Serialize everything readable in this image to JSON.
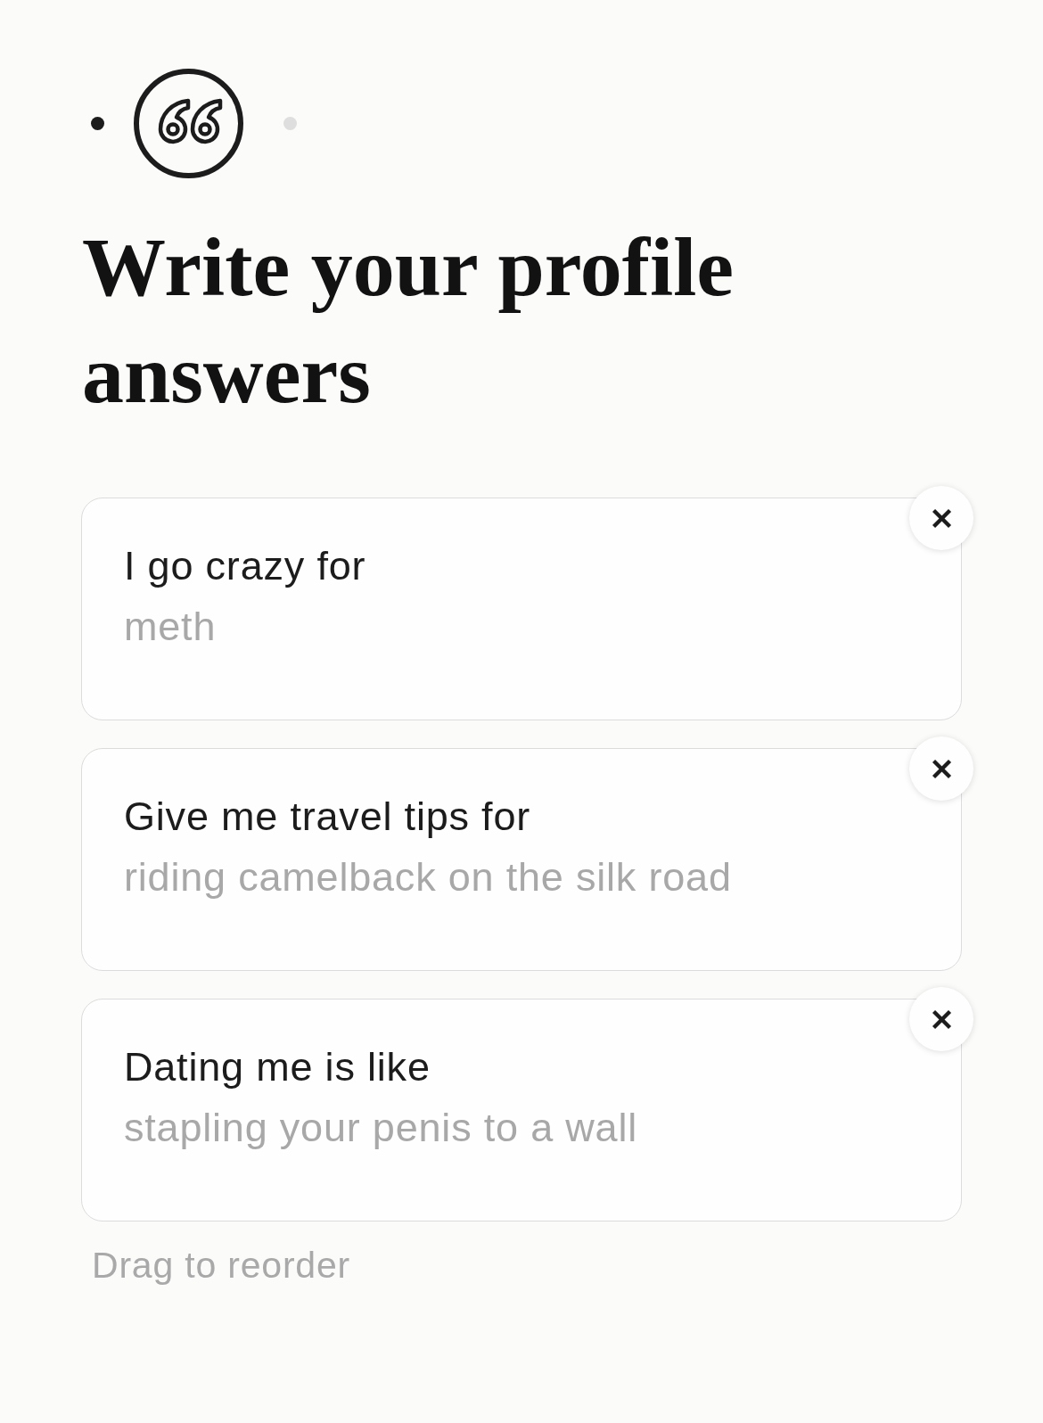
{
  "progress": {
    "steps": [
      {
        "kind": "dot",
        "completed": true
      },
      {
        "kind": "current"
      },
      {
        "kind": "dot",
        "completed": false
      }
    ]
  },
  "title": "Write your profile answers",
  "prompts": [
    {
      "prompt": "I go crazy for",
      "answer": "meth"
    },
    {
      "prompt": "Give me travel tips for",
      "answer": "riding camelback on the silk road"
    },
    {
      "prompt": "Dating me is like",
      "answer": "stapling your penis to a wall"
    }
  ],
  "hint": "Drag to reorder"
}
